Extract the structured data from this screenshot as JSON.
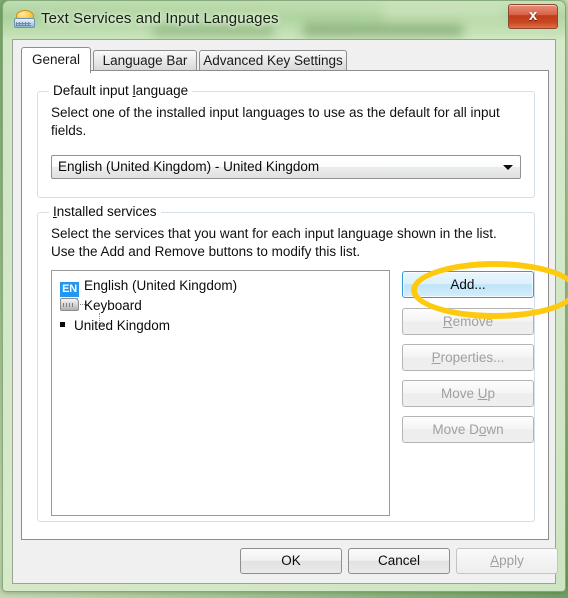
{
  "window": {
    "title": "Text Services and Input Languages",
    "icon": "keyboard-language-icon",
    "close_label": "x"
  },
  "tabs": [
    {
      "id": "general",
      "label": "General",
      "active": true
    },
    {
      "id": "language-bar",
      "label": "Language Bar",
      "active": false
    },
    {
      "id": "advanced",
      "label": "Advanced Key Settings",
      "active": false
    }
  ],
  "default_input_language": {
    "legend_before": "Default input ",
    "legend_accel": "l",
    "legend_after": "anguage",
    "description": "Select one of the installed input languages to use as the default for all input fields.",
    "combo_value": "English (United Kingdom) - United Kingdom",
    "combo_arrow": "chevron-down-icon"
  },
  "installed_services": {
    "legend_accel": "I",
    "legend_after": "nstalled services",
    "description": "Select the services that you want for each input language shown in the list. Use the Add and Remove buttons to modify this list.",
    "tree": {
      "language_badge": "EN",
      "language_label": "English (United Kingdom)",
      "category_label": "Keyboard",
      "layout_label": "United Kingdom"
    },
    "buttons": [
      {
        "id": "add",
        "label": "Add...",
        "accel": "",
        "enabled": true,
        "highlighted": true
      },
      {
        "id": "remove",
        "label": "emove",
        "accel": "R",
        "enabled": false,
        "highlighted": false
      },
      {
        "id": "properties",
        "label": "roperties...",
        "accel": "P",
        "enabled": false,
        "highlighted": false
      },
      {
        "id": "moveup",
        "label": "Move ",
        "accel": "U",
        "enabled": false,
        "highlighted": false
      },
      {
        "id": "movedown",
        "label": "Move D",
        "accel": "o",
        "enabled": false,
        "highlighted": false
      }
    ]
  },
  "buttons_split": {
    "remove_pre": "",
    "properties_pre": "",
    "moveup_post": "p",
    "movedown_post": "wn"
  },
  "dialog_buttons": [
    {
      "id": "ok",
      "label": "OK",
      "enabled": true
    },
    {
      "id": "cancel",
      "label": "Cancel",
      "enabled": true
    },
    {
      "id": "apply",
      "label": "pply",
      "accel": "A",
      "enabled": false
    }
  ],
  "annotation": {
    "type": "ellipse-highlight",
    "target": "add-button",
    "color": "#ffc90e"
  },
  "colors": {
    "accent_focus_border": "#2f9ed6",
    "badge_blue": "#2196f3",
    "close_red": "#bf3c1d",
    "aero_green": "#9cc089",
    "highlight_yellow": "#ffc90e"
  }
}
